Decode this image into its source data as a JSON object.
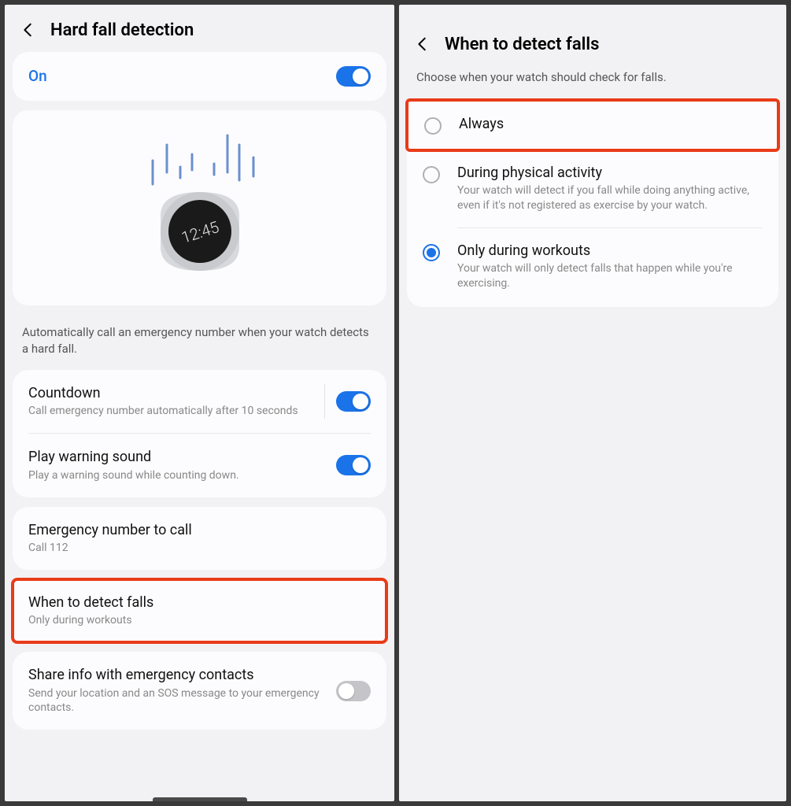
{
  "left": {
    "title": "Hard fall detection",
    "toggle": {
      "label": "On"
    },
    "illustration_time": "12:45",
    "description": "Automatically call an emergency number when your watch detects a hard fall.",
    "settings": [
      {
        "title": "Countdown",
        "sub": "Call emergency number automatically after 10 seconds",
        "switch": true,
        "divider": true
      },
      {
        "title": "Play warning sound",
        "sub": "Play a warning sound while counting down.",
        "switch": true
      }
    ],
    "settings2": [
      {
        "title": "Emergency number to call",
        "sub": "Call 112"
      }
    ],
    "when": {
      "title": "When to detect falls",
      "sub": "Only during workouts"
    },
    "share": {
      "title": "Share info with emergency contacts",
      "sub": "Send your location and an SOS message to your emergency contacts.",
      "switch": false
    }
  },
  "right": {
    "title": "When to detect falls",
    "description": "Choose when your watch should check for falls.",
    "options": [
      {
        "title": "Always",
        "sub": "",
        "selected": false,
        "highlight": true
      },
      {
        "title": "During physical activity",
        "sub": "Your watch will detect if you fall while doing anything active, even if it's not registered as exercise by your watch.",
        "selected": false
      },
      {
        "title": "Only during workouts",
        "sub": "Your watch will only detect falls that happen while you're exercising.",
        "selected": true
      }
    ]
  }
}
